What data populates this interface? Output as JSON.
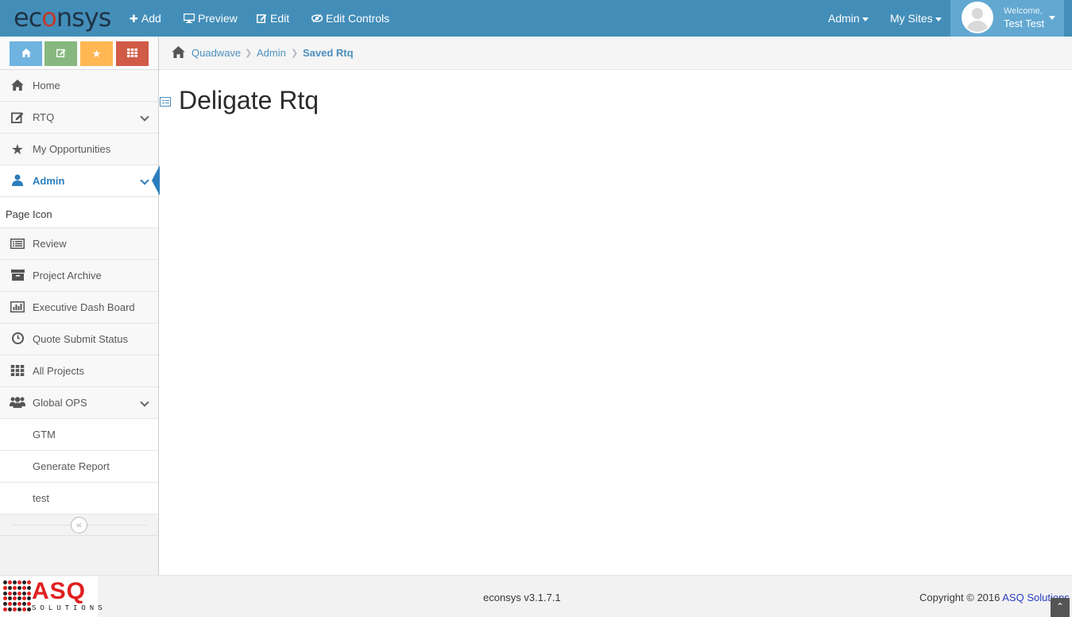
{
  "navbar": {
    "brand_pre": "ec",
    "brand_o": "o",
    "brand_post": "nsys",
    "add_label": "Add",
    "preview_label": "Preview",
    "edit_label": "Edit",
    "edit_controls_label": "Edit Controls",
    "admin_label": "Admin",
    "my_sites_label": "My Sites",
    "welcome": "Welcome,",
    "username": "Test Test"
  },
  "shortcuts": {
    "home_icon": "home-icon",
    "edit_icon": "pencil-icon",
    "star_icon": "star-icon",
    "grid_icon": "grid-icon"
  },
  "sidebar": {
    "items": [
      {
        "label": "Home",
        "icon": "home-icon"
      },
      {
        "label": "RTQ",
        "icon": "edit-icon"
      },
      {
        "label": "My Opportunities",
        "icon": "star-icon"
      },
      {
        "label": "Admin",
        "icon": "user-icon"
      }
    ],
    "page_icon_header": "Page Icon",
    "admin_items": [
      {
        "label": "Review",
        "icon": "list-icon"
      },
      {
        "label": "Project Archive",
        "icon": "archive-icon"
      },
      {
        "label": "Executive Dash Board",
        "icon": "bar-chart-icon"
      },
      {
        "label": "Quote Submit Status",
        "icon": "clock-icon"
      },
      {
        "label": "All Projects",
        "icon": "grid-icon"
      },
      {
        "label": "Global OPS",
        "icon": "users-icon"
      }
    ],
    "global_ops_items": [
      "GTM",
      "Generate Report",
      "test"
    ]
  },
  "breadcrumbs": {
    "items": [
      "Quadwave",
      "Admin",
      "Saved Rtq"
    ]
  },
  "page": {
    "title": "Deligate Rtq"
  },
  "footer": {
    "logo_text": "ASQ",
    "logo_sub": "SOLUTIONS",
    "version": "econsys v3.1.7.1",
    "copyright_prefix": "Copyright © 2016",
    "copyright_link": "ASQ Solutions"
  },
  "colors": {
    "navbar": "#438eb9",
    "user_box": "#62a8d1",
    "active": "#2b7dbc",
    "shortcut_blue": "#6fb3e0",
    "shortcut_green": "#87b87f",
    "shortcut_yellow": "#ffb752",
    "shortcut_red": "#d15b47"
  }
}
